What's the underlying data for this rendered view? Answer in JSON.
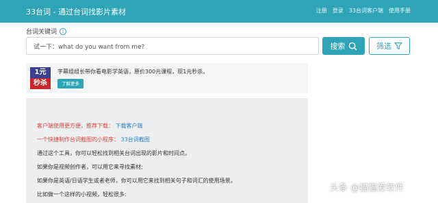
{
  "header": {
    "brand": "33台词 - 通过台词找影片素材",
    "links": [
      "注册",
      "登录",
      "33台词客户端",
      "使用手册"
    ]
  },
  "search": {
    "label": "台词关键词",
    "value": "试一下：what do you want from me?",
    "search_button": "搜索",
    "filter_button": "筛选"
  },
  "promo": {
    "badge_top": "1元",
    "badge_bottom": "秒杀",
    "text": "字幕组组长带你看电影学英语，原价300元课程，现1元秒杀。",
    "button": "了解更多"
  },
  "content": {
    "client_prefix": "客户端使用更方便，推荐下载：",
    "client_link": "下载客户端",
    "mini_prefix": "一个快捷制作台词截图的小程序：",
    "mini_link": "33台词截图",
    "p1": "通过这个工具，你可以轻松找到相关台词出现的影片和时间点。",
    "p2": "如果你是视频创作者，可以用它来寻找素材;",
    "p3": "如果你是英语/日语学生或者老师，你可以用它来找到相关句子和词汇的使用场景。",
    "p4": "比如做一个这样的小视频，轻松很多:"
  },
  "watermark": "头条 @猫猫爱软件",
  "colors": {
    "accent": "#2fa4b7",
    "red": "#e0403c",
    "link": "#2a7fd1"
  },
  "icons": {
    "info": "info-icon",
    "search": "search-icon",
    "filter": "filter-icon"
  }
}
